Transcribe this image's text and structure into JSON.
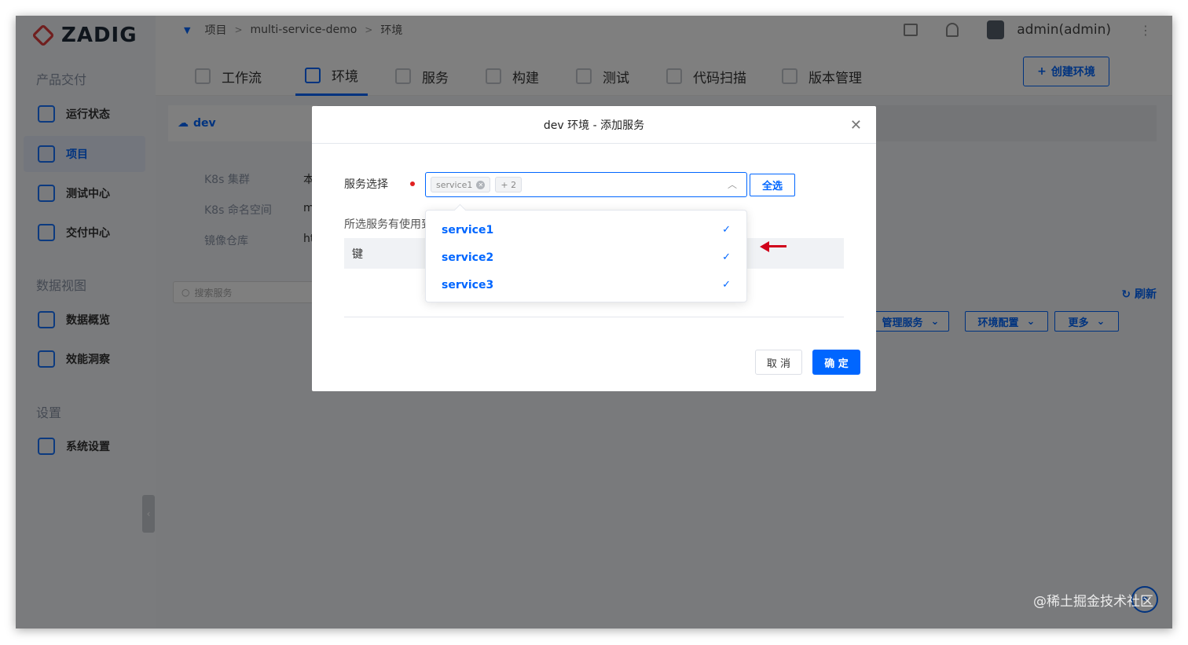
{
  "app": {
    "logo_text": "ZADIG",
    "brand_color": "#e03e3e",
    "accent_color": "#0066ff"
  },
  "sidebar": {
    "section_product": "产品交付",
    "section_data": "数据视图",
    "section_settings": "设置",
    "items": [
      {
        "label": "运行状态",
        "icon": "pulse-icon"
      },
      {
        "label": "项目",
        "icon": "project-icon"
      },
      {
        "label": "测试中心",
        "icon": "flask-icon"
      },
      {
        "label": "交付中心",
        "icon": "box-icon"
      },
      {
        "label": "数据概览",
        "icon": "chart-icon"
      },
      {
        "label": "效能洞察",
        "icon": "pie-icon"
      },
      {
        "label": "系统设置",
        "icon": "gear-icon"
      }
    ]
  },
  "topbar": {
    "breadcrumb": [
      "项目",
      "multi-service-demo",
      "环境"
    ],
    "separator": ">",
    "username": "admin(admin)"
  },
  "tabs": {
    "items": [
      "工作流",
      "环境",
      "服务",
      "构建",
      "测试",
      "代码扫描",
      "版本管理"
    ],
    "active": "环境",
    "create_label": "创建环境"
  },
  "content": {
    "env_tab": "dev",
    "info_labels": [
      "K8s 集群",
      "K8s 命名空间",
      "镜像仓库"
    ],
    "info_values": [
      "本",
      "m",
      "ht"
    ],
    "actions": [
      "管理服务",
      "环境配置",
      "更多"
    ],
    "search_placeholder": "搜索服务",
    "refresh_label": "刷新"
  },
  "modal": {
    "title": "dev 环境 - 添加服务",
    "field_label": "服务选择",
    "selected_tag": "service1",
    "more_count": "+ 2",
    "select_all_label": "全选",
    "sub_label": "所选服务有使用到",
    "kv_header": "键",
    "cancel_label": "取 消",
    "ok_label": "确 定",
    "options": [
      {
        "label": "service1",
        "checked": true
      },
      {
        "label": "service2",
        "checked": true
      },
      {
        "label": "service3",
        "checked": true
      }
    ]
  },
  "watermark": "@稀土掘金技术社区"
}
